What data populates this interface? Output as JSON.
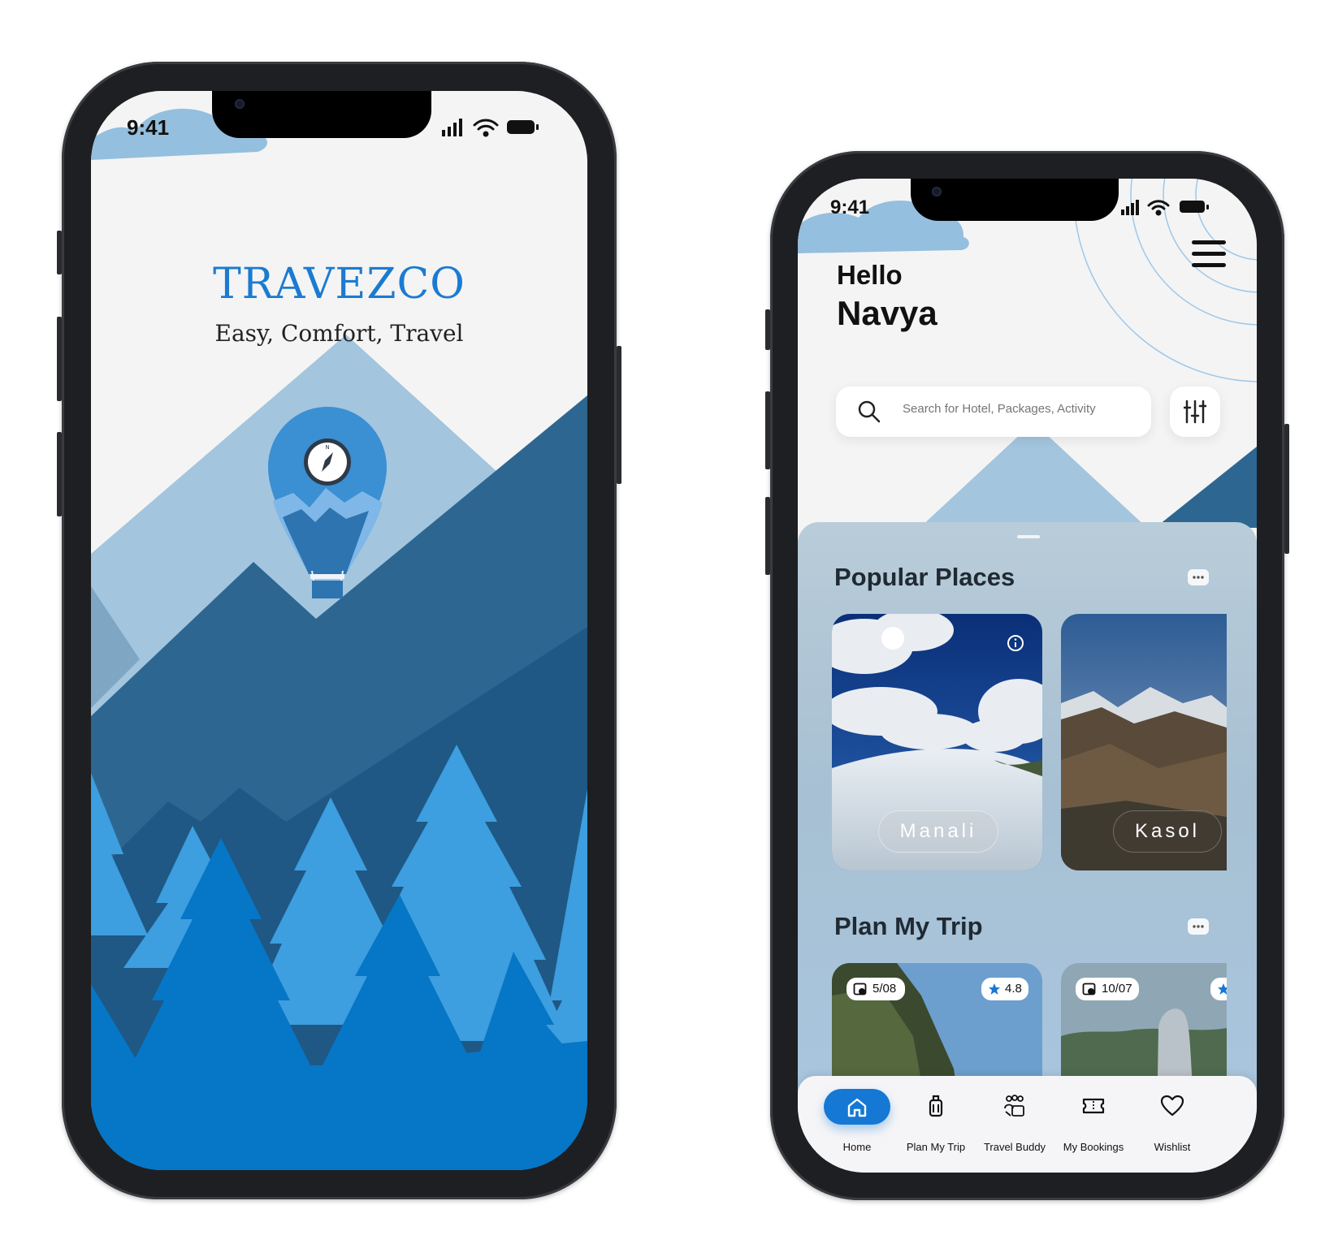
{
  "splash": {
    "status_time": "9:41",
    "brand_title": "TRAVEZCO",
    "tagline": "Easy, Comfort, Travel"
  },
  "home": {
    "status_time": "9:41",
    "greeting": "Hello",
    "user_name": "Navya",
    "search": {
      "placeholder": "Search for Hotel, Packages, Activity"
    },
    "popular_places": {
      "title": "Popular Places",
      "places": [
        {
          "label": "Manali"
        },
        {
          "label": "Kasol"
        }
      ]
    },
    "plan_my_trip": {
      "title": "Plan My Trip",
      "trips": [
        {
          "date": "5/08",
          "rating": "4.8"
        },
        {
          "date": "10/07"
        }
      ]
    },
    "tabs": [
      {
        "label": "Home",
        "icon": "home-icon",
        "active": true
      },
      {
        "label": "Plan My Trip",
        "icon": "luggage-icon"
      },
      {
        "label": "Travel Buddy",
        "icon": "group-icon"
      },
      {
        "label": "My Bookings",
        "icon": "ticket-icon"
      },
      {
        "label": "Wishlist",
        "icon": "heart-icon"
      }
    ]
  },
  "colors": {
    "brand_blue": "#1b7bd1",
    "active_tab": "#1478d4",
    "sky_light": "#a3c5de",
    "mountain_dark": "#2d6791",
    "tree_light": "#3d9ee0",
    "tree_dark": "#0676c6"
  }
}
